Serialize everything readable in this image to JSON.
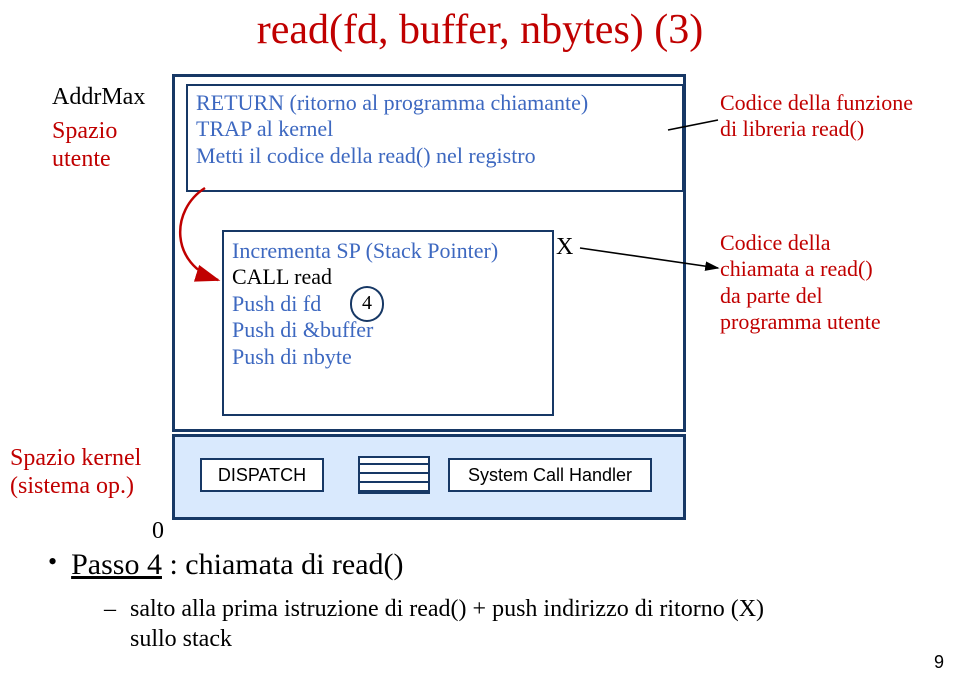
{
  "title": "read(fd, buffer, nbytes) (3)",
  "labels": {
    "addrmax": "AddrMax",
    "spazio_utente_l1": "Spazio",
    "spazio_utente_l2": "utente",
    "spazio_kernel_l1": "Spazio kernel",
    "spazio_kernel_l2": "(sistema op.)",
    "zero": "0",
    "x": "X",
    "page": "9"
  },
  "lib_code": {
    "l1": "RETURN (ritorno al programma chiamante)",
    "l2": "TRAP al kernel",
    "l3": "Metti il codice della read() nel registro"
  },
  "caller_code": {
    "l1": "Incrementa SP (Stack Pointer)",
    "l2": "CALL read",
    "l3": "Push di fd",
    "l4": "Push di &buffer",
    "l5": "Push di nbyte",
    "step": "4"
  },
  "kernel": {
    "dispatch": "DISPATCH",
    "handler": "System Call Handler"
  },
  "anno": {
    "a1_l1": "Codice della funzione",
    "a1_l2": "di libreria read()",
    "a2_l1": "Codice della",
    "a2_l2": "chiamata a read()",
    "a2_l3": "da parte del",
    "a2_l4": "programma utente"
  },
  "bullet": {
    "main_pre": "Passo 4",
    "main_post": " : chiamata di read()",
    "sub_l1": "salto alla prima istruzione di read() + push indirizzo di ritorno (X)",
    "sub_l2": "sullo stack"
  },
  "chart_data": {
    "type": "diagram",
    "description": "Memory-layout diagram illustrating step 4 of the read() library call sequence.",
    "regions": [
      {
        "name": "Spazio utente",
        "range": "AddrMax .. above kernel",
        "boxes": [
          {
            "name": "Codice libreria read()",
            "lines": [
              "RETURN (ritorno al programma chiamante)",
              "TRAP al kernel",
              "Metti il codice della read() nel registro"
            ]
          },
          {
            "name": "Codice chiamante",
            "lines": [
              "Incrementa SP (Stack Pointer)",
              "CALL read",
              "Push di fd",
              "Push di &buffer",
              "Push di nbyte"
            ],
            "return_address_marker": "X",
            "current_step": 4
          }
        ]
      },
      {
        "name": "Spazio kernel (sistema op.)",
        "range": "0 .. low",
        "boxes": [
          "DISPATCH",
          "(table)",
          "System Call Handler"
        ]
      }
    ],
    "arrows": [
      {
        "from": "box-top bottom-left",
        "to": "CALL read line",
        "color": "#c00000",
        "meaning": "step 4: call into read()"
      },
      {
        "from": "X marker",
        "to": "annotation 'Codice della chiamata a read()'",
        "color": "#000"
      },
      {
        "from": "box-top right",
        "to": "annotation 'Codice della funzione di libreria read()'",
        "color": "#000"
      }
    ]
  }
}
